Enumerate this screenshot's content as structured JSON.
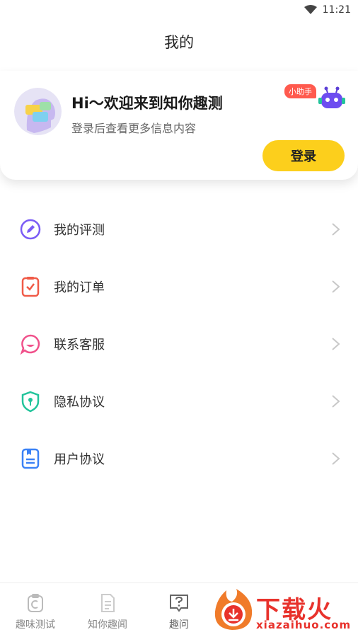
{
  "status": {
    "time": "11:21"
  },
  "header": {
    "title": "我的"
  },
  "profile": {
    "welcome": "Hi～欢迎来到知你趣测",
    "subtitle": "登录后查看更多信息内容",
    "helper_badge": "小助手",
    "login_label": "登录"
  },
  "menu": [
    {
      "label": "我的评测",
      "icon": "edit-circle-icon",
      "color": "#7b5cf5"
    },
    {
      "label": "我的订单",
      "icon": "order-check-icon",
      "color": "#f05a47"
    },
    {
      "label": "联系客服",
      "icon": "chat-bubble-icon",
      "color": "#f0508a"
    },
    {
      "label": "隐私协议",
      "icon": "shield-lock-icon",
      "color": "#22c49b"
    },
    {
      "label": "用户协议",
      "icon": "document-icon",
      "color": "#3b82f6"
    }
  ],
  "tabs": [
    {
      "label": "趣味测试",
      "icon": "clipboard-icon"
    },
    {
      "label": "知你趣闻",
      "icon": "news-icon"
    },
    {
      "label": "趣问",
      "icon": "question-icon"
    }
  ],
  "watermark": {
    "text": "下载火",
    "url": "xiazaihuo.com"
  },
  "colors": {
    "accent": "#fccf1c",
    "badge": "#ff5a4e",
    "watermark": "#e8322c"
  }
}
